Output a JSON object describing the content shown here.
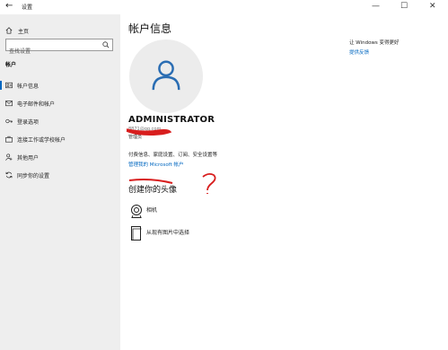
{
  "window": {
    "title": "设置",
    "back": "←",
    "minimize": "—",
    "maximize": "☐",
    "close": "✕"
  },
  "sidebar": {
    "home": "主页",
    "search_placeholder": "查找设置",
    "section": "帐户",
    "items": [
      {
        "label": "帐户信息",
        "icon": "person-card-icon",
        "active": true
      },
      {
        "label": "电子邮件和帐户",
        "icon": "mail-icon"
      },
      {
        "label": "登录选项",
        "icon": "key-icon"
      },
      {
        "label": "连接工作或学校帐户",
        "icon": "briefcase-icon"
      },
      {
        "label": "其他用户",
        "icon": "person-add-icon"
      },
      {
        "label": "同步你的设置",
        "icon": "sync-icon"
      }
    ]
  },
  "main": {
    "title": "帐户信息",
    "username": "ADMINISTRATOR",
    "email": "8871@qq.com",
    "role": "管理员",
    "billing": "付费信息、家庭设置、订阅、安全设置等",
    "ms_link": "管理我的 Microsoft 帐户",
    "create_avatar": "创建你的头像",
    "options": [
      {
        "label": "相机",
        "icon": "camera-icon"
      },
      {
        "label": "从现有图片中选择",
        "icon": "browse-icon"
      }
    ],
    "side_note": "让 Windows 变得更好",
    "feedback_link": "提供反馈"
  },
  "colors": {
    "accent": "#0067c0",
    "sidebar_bg": "#eeeeee",
    "annotation_red": "#d81e1e"
  }
}
